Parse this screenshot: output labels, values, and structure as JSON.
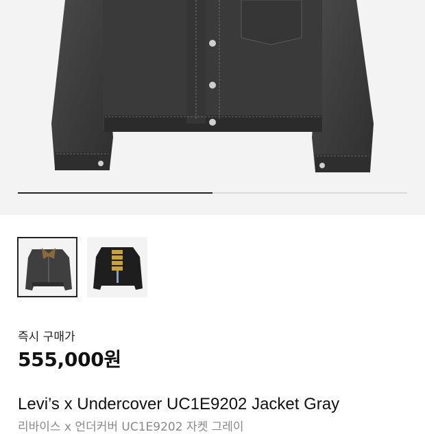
{
  "gallery": {
    "progress": 0.5,
    "thumbnails": [
      {
        "name": "front-view",
        "selected": true
      },
      {
        "name": "back-view",
        "selected": false
      }
    ]
  },
  "price_section": {
    "label": "즉시 구매가",
    "price": "555,000원"
  },
  "product": {
    "title": "Levi’s x Undercover UC1E9202 Jacket Gray",
    "subtitle": "리바이스 x 언더커버 UC1E9202 자켓 그레이"
  },
  "colors": {
    "denim": "#3d3d3d",
    "background": "#f3f3f3",
    "accent": "#222222"
  }
}
